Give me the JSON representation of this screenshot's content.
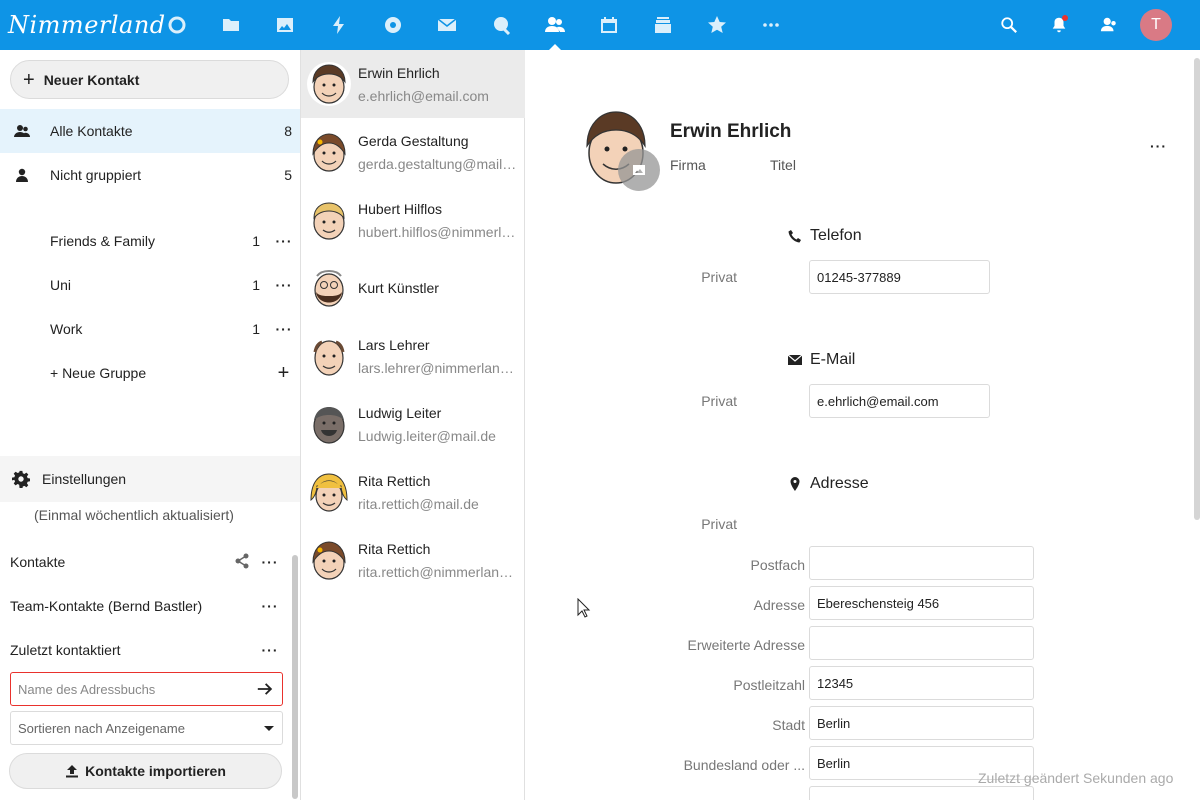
{
  "header": {
    "logo_text": "Nimmerland",
    "apps": [
      "dashboard-icon",
      "files-icon",
      "photos-icon",
      "activity-icon",
      "talk-icon",
      "mail-icon",
      "search-app-icon",
      "contacts-icon",
      "calendar-icon",
      "deck-icon",
      "favorites-icon",
      "more-apps-icon"
    ],
    "active_app": "contacts-icon",
    "user_initial": "T",
    "accent": "#0e94e6"
  },
  "nav": {
    "new_contact": "Neuer Kontakt",
    "all_contacts": {
      "label": "Alle Kontakte",
      "count": "8"
    },
    "ungrouped": {
      "label": "Nicht gruppiert",
      "count": "5"
    },
    "groups": [
      {
        "label": "Friends & Family",
        "count": "1"
      },
      {
        "label": "Uni",
        "count": "1"
      },
      {
        "label": "Work",
        "count": "1"
      }
    ],
    "new_group": "+ Neue Gruppe",
    "settings": "Einstellungen",
    "settings_note": "(Einmal wöchentlich aktualisiert)",
    "addressbooks": [
      {
        "name": "Kontakte"
      },
      {
        "name": "Team-Kontakte (Bernd Bastler)"
      },
      {
        "name": "Zuletzt kontaktiert"
      }
    ],
    "addressbook_placeholder": "Name des Adressbuchs",
    "sort_label": "Sortieren nach Anzeigename",
    "import_label": "Kontakte importieren"
  },
  "contacts": [
    {
      "name": "Erwin Ehrlich",
      "email": "e.ehrlich@email.com"
    },
    {
      "name": "Gerda Gestaltung",
      "email": "gerda.gestaltung@mail.de"
    },
    {
      "name": "Hubert Hilflos",
      "email": "hubert.hilflos@nimmerland.de"
    },
    {
      "name": "Kurt Künstler",
      "email": ""
    },
    {
      "name": "Lars Lehrer",
      "email": "lars.lehrer@nimmerland.de"
    },
    {
      "name": "Ludwig Leiter",
      "email": "Ludwig.leiter@mail.de"
    },
    {
      "name": "Rita Rettich",
      "email": "rita.rettich@mail.de"
    },
    {
      "name": "Rita Rettich",
      "email": "rita.rettich@nimmerland.de"
    }
  ],
  "details": {
    "name": "Erwin Ehrlich",
    "firma": "Firma",
    "titel": "Titel",
    "telefon": {
      "heading": "Telefon",
      "type": "Privat",
      "value": "01245-377889"
    },
    "email": {
      "heading": "E-Mail",
      "type": "Privat",
      "value": "e.ehrlich@email.com"
    },
    "adresse": {
      "heading": "Adresse",
      "type": "Privat",
      "fields": [
        {
          "label": "Postfach",
          "value": ""
        },
        {
          "label": "Adresse",
          "value": "Ebereschensteig 456"
        },
        {
          "label": "Erweiterte Adresse",
          "value": ""
        },
        {
          "label": "Postleitzahl",
          "value": "12345"
        },
        {
          "label": "Stadt",
          "value": "Berlin"
        },
        {
          "label": "Bundesland oder ...",
          "value": "Berlin"
        }
      ]
    },
    "footer": "Zuletzt geändert Sekunden ago"
  }
}
